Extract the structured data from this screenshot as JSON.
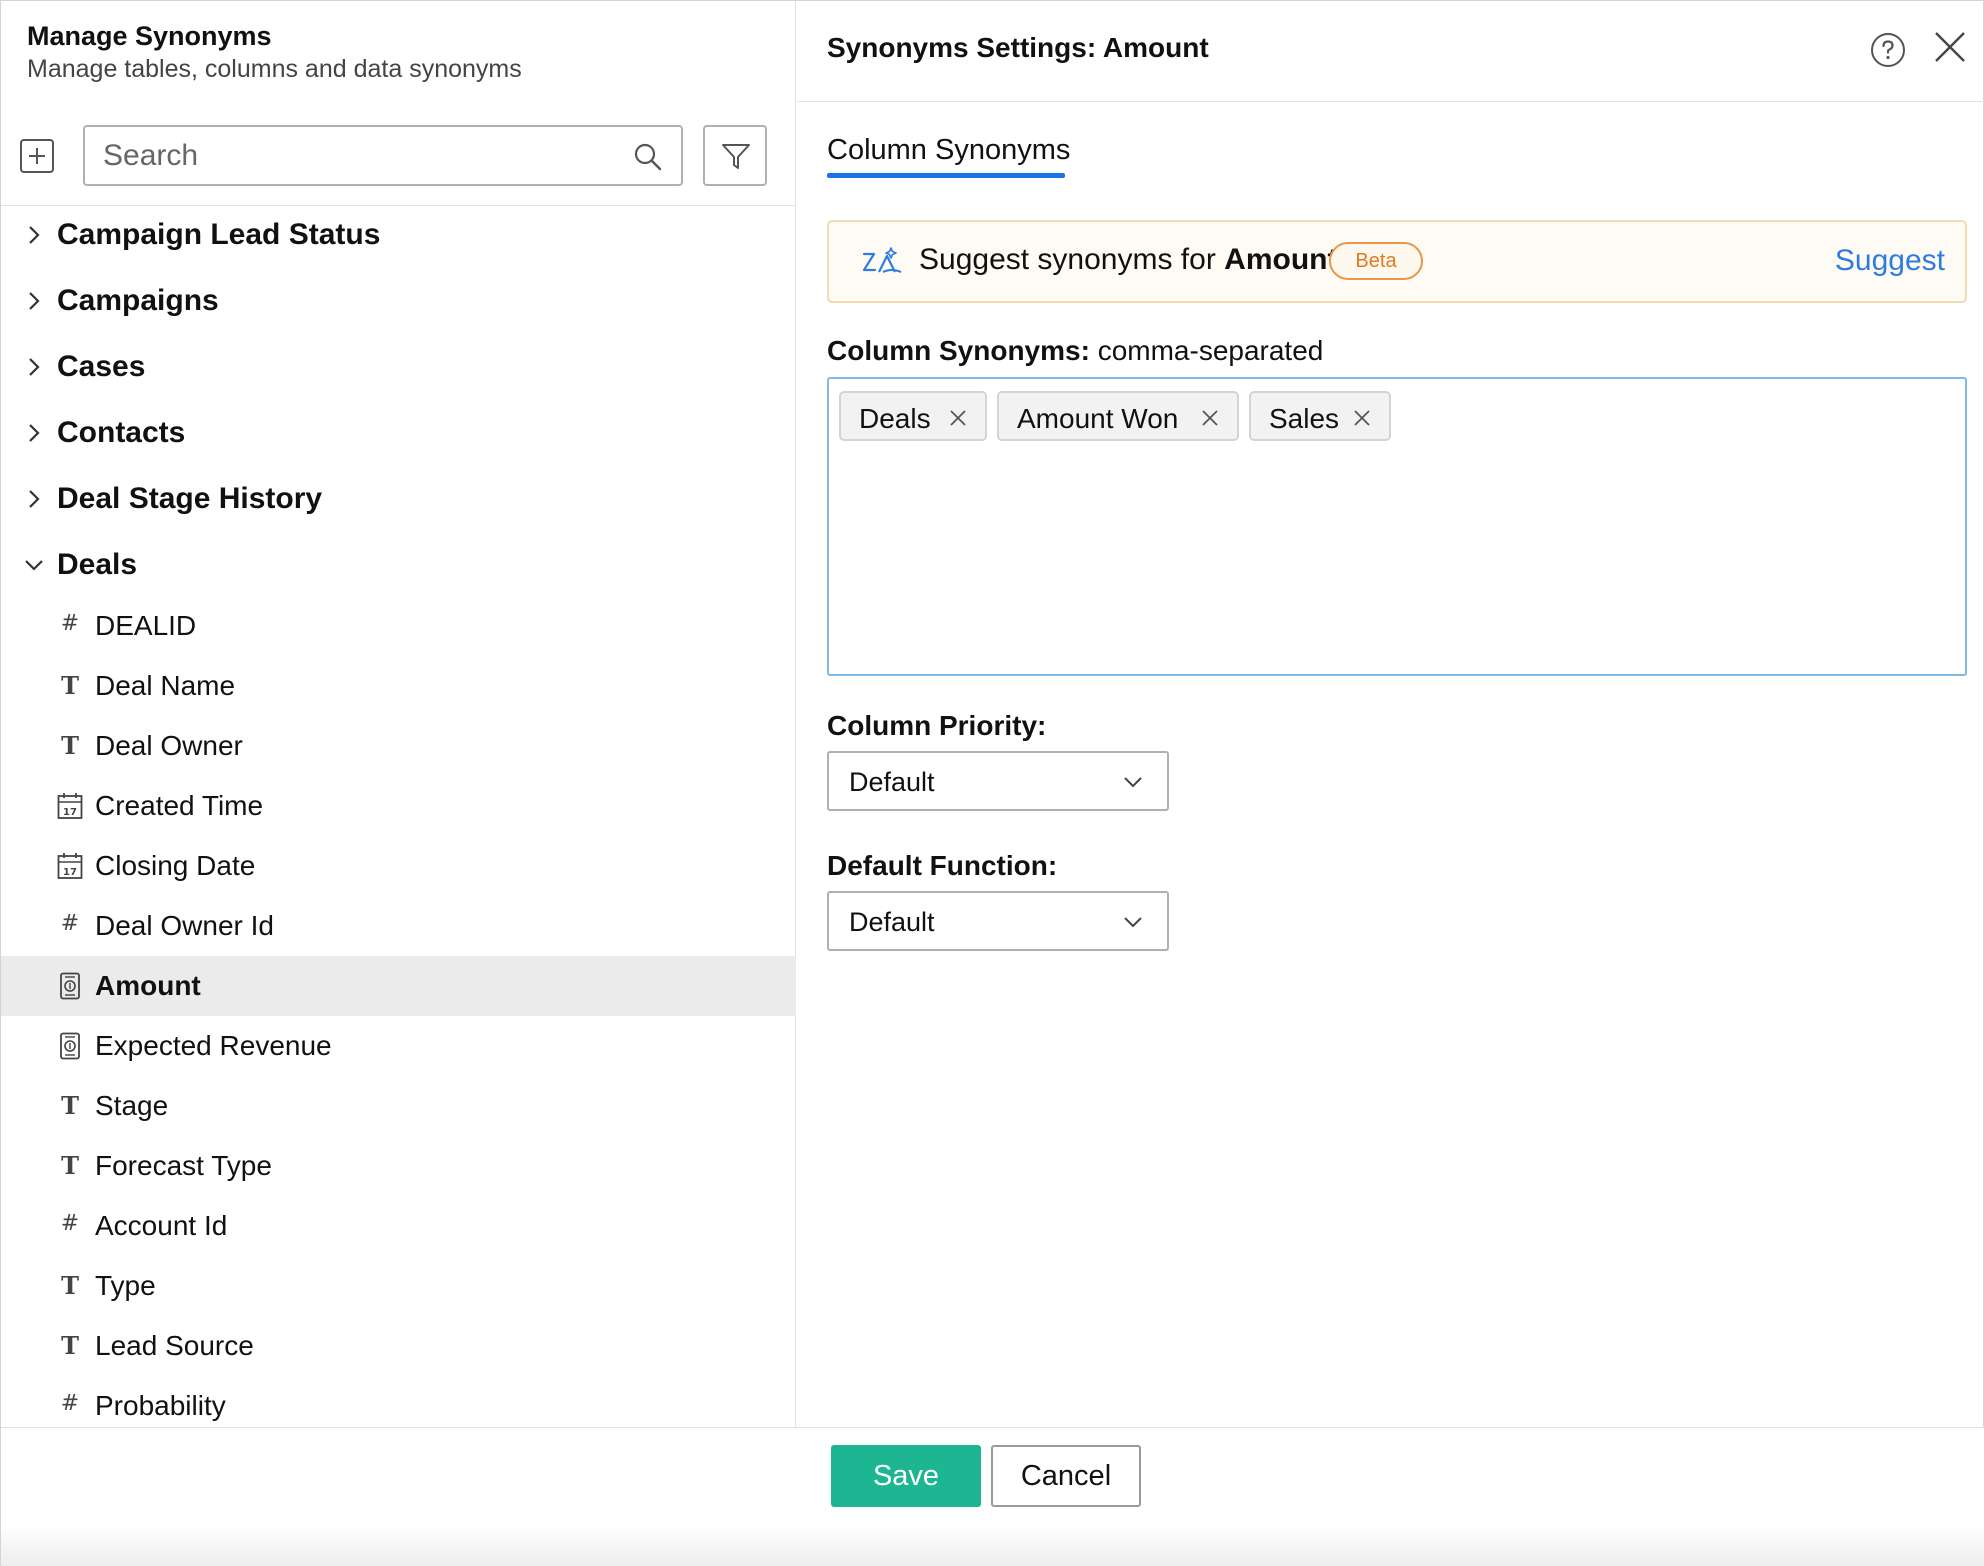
{
  "left": {
    "title": "Manage Synonyms",
    "subtitle": "Manage tables, columns and data synonyms",
    "search_placeholder": "Search",
    "groups": [
      {
        "label": "Campaign Lead Status",
        "expanded": false
      },
      {
        "label": "Campaigns",
        "expanded": false
      },
      {
        "label": "Cases",
        "expanded": false
      },
      {
        "label": "Contacts",
        "expanded": false
      },
      {
        "label": "Deal Stage History",
        "expanded": false
      },
      {
        "label": "Deals",
        "expanded": true
      }
    ],
    "columns": [
      {
        "icon": "hash-icon",
        "label": "DEALID"
      },
      {
        "icon": "text-type-icon",
        "label": "Deal Name"
      },
      {
        "icon": "text-type-icon",
        "label": "Deal Owner"
      },
      {
        "icon": "calendar-icon",
        "label": "Created Time"
      },
      {
        "icon": "calendar-icon",
        "label": "Closing Date"
      },
      {
        "icon": "hash-icon",
        "label": "Deal Owner Id"
      },
      {
        "icon": "currency-icon",
        "label": "Amount",
        "selected": true
      },
      {
        "icon": "currency-icon",
        "label": "Expected Revenue"
      },
      {
        "icon": "text-type-icon",
        "label": "Stage"
      },
      {
        "icon": "text-type-icon",
        "label": "Forecast Type"
      },
      {
        "icon": "hash-icon",
        "label": "Account Id"
      },
      {
        "icon": "text-type-icon",
        "label": "Type"
      },
      {
        "icon": "text-type-icon",
        "label": "Lead Source"
      },
      {
        "icon": "hash-icon",
        "label": "Probability"
      }
    ],
    "calendar_day": "17"
  },
  "right": {
    "title": "Synonyms Settings: Amount",
    "tab_label": "Column Synonyms",
    "suggest": {
      "prefix": "Suggest synonyms for ",
      "column": "Amount",
      "badge": "Beta",
      "link": "Suggest"
    },
    "synonyms_label": "Column Synonyms:",
    "synonyms_hint": " comma-separated",
    "chips": [
      "Deals",
      "Amount Won",
      "Sales"
    ],
    "priority_label": "Column Priority:",
    "priority_value": "Default",
    "function_label": "Default Function:",
    "function_value": "Default"
  },
  "footer": {
    "save": "Save",
    "cancel": "Cancel"
  },
  "colors": {
    "accent_blue": "#1a73e8",
    "save_green": "#1db592",
    "beta_orange": "#e07b1f",
    "link_blue": "#2f7ce0",
    "selected_row": "#ebebeb"
  }
}
